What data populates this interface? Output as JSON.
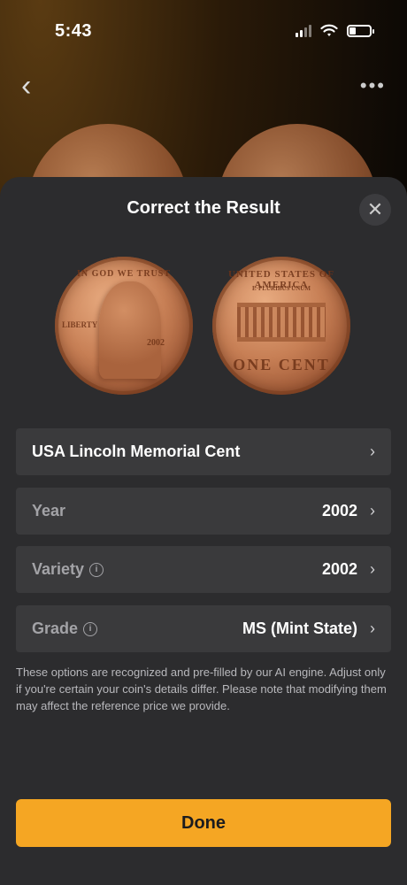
{
  "status_bar": {
    "time": "5:43"
  },
  "sheet": {
    "title": "Correct the Result",
    "rows": [
      {
        "label": "USA Lincoln Memorial Cent",
        "value": ""
      },
      {
        "label": "Year",
        "value": "2002"
      },
      {
        "label": "Variety",
        "value": "2002"
      },
      {
        "label": "Grade",
        "value": "MS (Mint State)"
      }
    ],
    "note": "These options are recognized and pre-filled by our AI engine. Adjust only if you're certain your coin's details differ. Please note that modifying them may affect the reference price we provide.",
    "done_label": "Done"
  },
  "coin_obverse": {
    "motto": "IN GOD WE TRUST",
    "liberty": "LIBERTY",
    "year": "2002"
  },
  "coin_reverse": {
    "country": "UNITED STATES OF AMERICA",
    "eplur": "E·PLURIBUS UNUM",
    "denomination": "ONE CENT"
  },
  "icons": {
    "back": "chevron-left-icon",
    "more": "ellipsis-icon",
    "close": "close-icon",
    "info": "info-icon",
    "chevron": "chevron-right-icon"
  },
  "colors": {
    "accent": "#f5a623",
    "sheet": "#2c2c2e",
    "row": "#3a3a3c"
  }
}
